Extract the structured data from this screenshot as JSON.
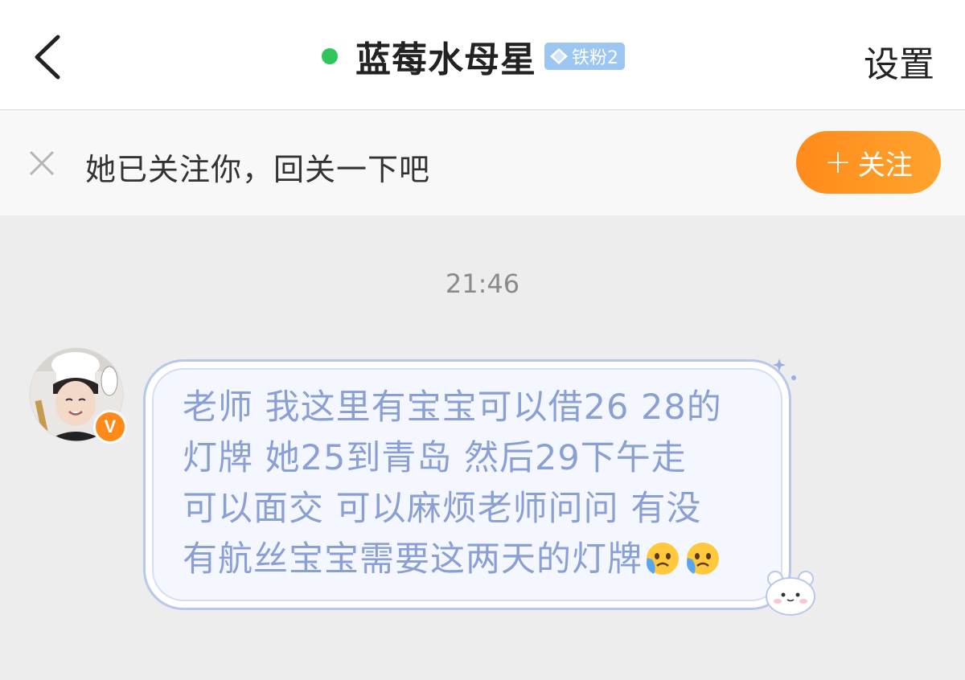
{
  "header": {
    "title": "蓝莓水母星",
    "fan_badge": "铁粉2",
    "settings_label": "设置",
    "online_status_color": "#2ec55a"
  },
  "follow_bar": {
    "message": "她已关注你，回关一下吧",
    "follow_label": "关注",
    "follow_plus": "+"
  },
  "chat": {
    "timestamp": "21:46",
    "message_lines": [
      "老师 我这里有宝宝可以借26 28的",
      "灯牌 她25到青岛 然后29下午走",
      "可以面交 可以麻烦老师问问 有没",
      "有航丝宝宝需要这两天的灯牌"
    ],
    "emoji_names": [
      "crying-face-icon",
      "crying-face-icon"
    ],
    "sender_badge": "V"
  },
  "colors": {
    "accent_orange": "#ff9a22",
    "bubble_text": "#8a9fd4",
    "bubble_border": "#b9c7ea"
  }
}
